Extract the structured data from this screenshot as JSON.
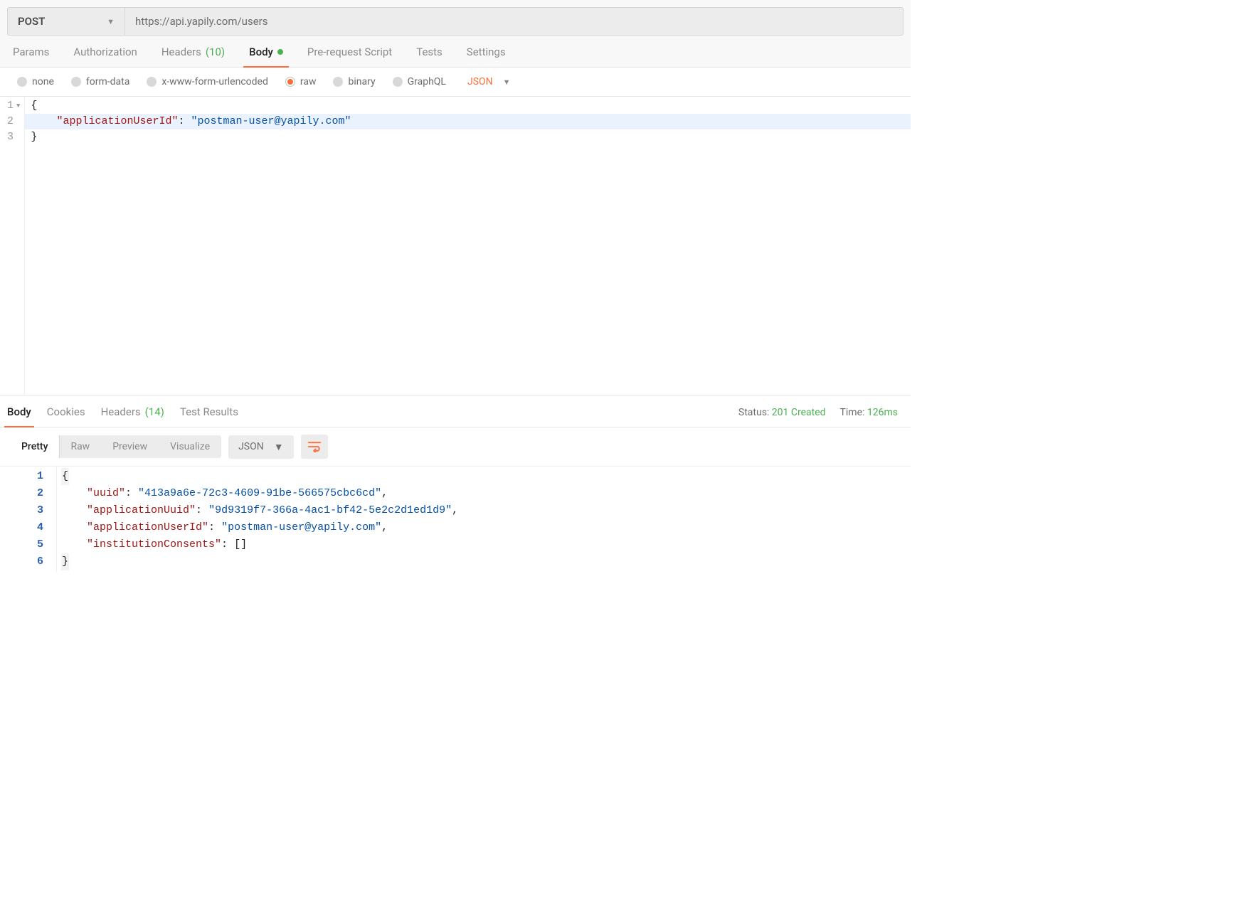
{
  "request": {
    "method": "POST",
    "url": "https://api.yapily.com/users"
  },
  "tabs": {
    "params": "Params",
    "authorization": "Authorization",
    "headers": "Headers",
    "headers_count": "(10)",
    "body": "Body",
    "prerequest": "Pre-request Script",
    "tests": "Tests",
    "settings": "Settings"
  },
  "body_type": {
    "none": "none",
    "form_data": "form-data",
    "url_encoded": "x-www-form-urlencoded",
    "raw": "raw",
    "binary": "binary",
    "graphql": "GraphQL",
    "format": "JSON"
  },
  "request_body": {
    "ln1": "1",
    "ln2": "2",
    "ln3": "3",
    "open_brace": "{",
    "key": "\"applicationUserId\"",
    "colon": ": ",
    "value": "\"postman-user@yapily.com\"",
    "close_brace": "}"
  },
  "response_tabs": {
    "body": "Body",
    "cookies": "Cookies",
    "headers": "Headers",
    "headers_count": "(14)",
    "test_results": "Test Results"
  },
  "response_meta": {
    "status_label": "Status:",
    "status_value": "201 Created",
    "time_label": "Time:",
    "time_value": "126ms"
  },
  "response_toolbar": {
    "pretty": "Pretty",
    "raw": "Raw",
    "preview": "Preview",
    "visualize": "Visualize",
    "format": "JSON"
  },
  "response_body": {
    "ln1": "1",
    "ln2": "2",
    "ln3": "3",
    "ln4": "4",
    "ln5": "5",
    "ln6": "6",
    "open_brace": "{",
    "k_uuid": "\"uuid\"",
    "v_uuid": "\"413a9a6e-72c3-4609-91be-566575cbc6cd\"",
    "k_appuuid": "\"applicationUuid\"",
    "v_appuuid": "\"9d9319f7-366a-4ac1-bf42-5e2c2d1ed1d9\"",
    "k_appuserid": "\"applicationUserId\"",
    "v_appuserid": "\"postman-user@yapily.com\"",
    "k_consents": "\"institutionConsents\"",
    "v_consents": "[]",
    "colon": ": ",
    "comma": ",",
    "close_brace": "}"
  }
}
